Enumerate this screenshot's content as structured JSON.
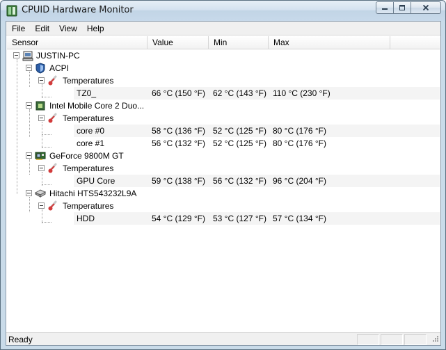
{
  "window": {
    "title": "CPUID Hardware Monitor"
  },
  "menu": {
    "file": "File",
    "edit": "Edit",
    "view": "View",
    "help": "Help"
  },
  "columns": {
    "sensor": "Sensor",
    "value": "Value",
    "min": "Min",
    "max": "Max"
  },
  "tree": {
    "root": "JUSTIN-PC",
    "acpi": {
      "name": "ACPI",
      "group": "Temperatures",
      "tz0": {
        "name": "TZ0_",
        "value": "66 °C  (150 °F)",
        "min": "62 °C  (143 °F)",
        "max": "110 °C  (230 °F)"
      }
    },
    "cpu": {
      "name": "Intel Mobile Core 2 Duo...",
      "group": "Temperatures",
      "core0": {
        "name": "core #0",
        "value": "58 °C  (136 °F)",
        "min": "52 °C  (125 °F)",
        "max": "80 °C  (176 °F)"
      },
      "core1": {
        "name": "core #1",
        "value": "56 °C  (132 °F)",
        "min": "52 °C  (125 °F)",
        "max": "80 °C  (176 °F)"
      }
    },
    "gpu": {
      "name": "GeForce 9800M GT",
      "group": "Temperatures",
      "core": {
        "name": "GPU Core",
        "value": "59 °C  (138 °F)",
        "min": "56 °C  (132 °F)",
        "max": "96 °C  (204 °F)"
      }
    },
    "hdd": {
      "name": "Hitachi HTS543232L9A",
      "group": "Temperatures",
      "disk": {
        "name": "HDD",
        "value": "54 °C  (129 °F)",
        "min": "53 °C  (127 °F)",
        "max": "57 °C  (134 °F)"
      }
    }
  },
  "status": {
    "text": "Ready"
  },
  "icons": {
    "app": "cpuid-app-icon",
    "computer": "computer-icon",
    "acpi": "acpi-shield-icon",
    "cpu": "cpu-chip-icon",
    "gpu": "gpu-card-icon",
    "hdd": "hard-disk-icon",
    "thermometer": "thermometer-icon"
  }
}
